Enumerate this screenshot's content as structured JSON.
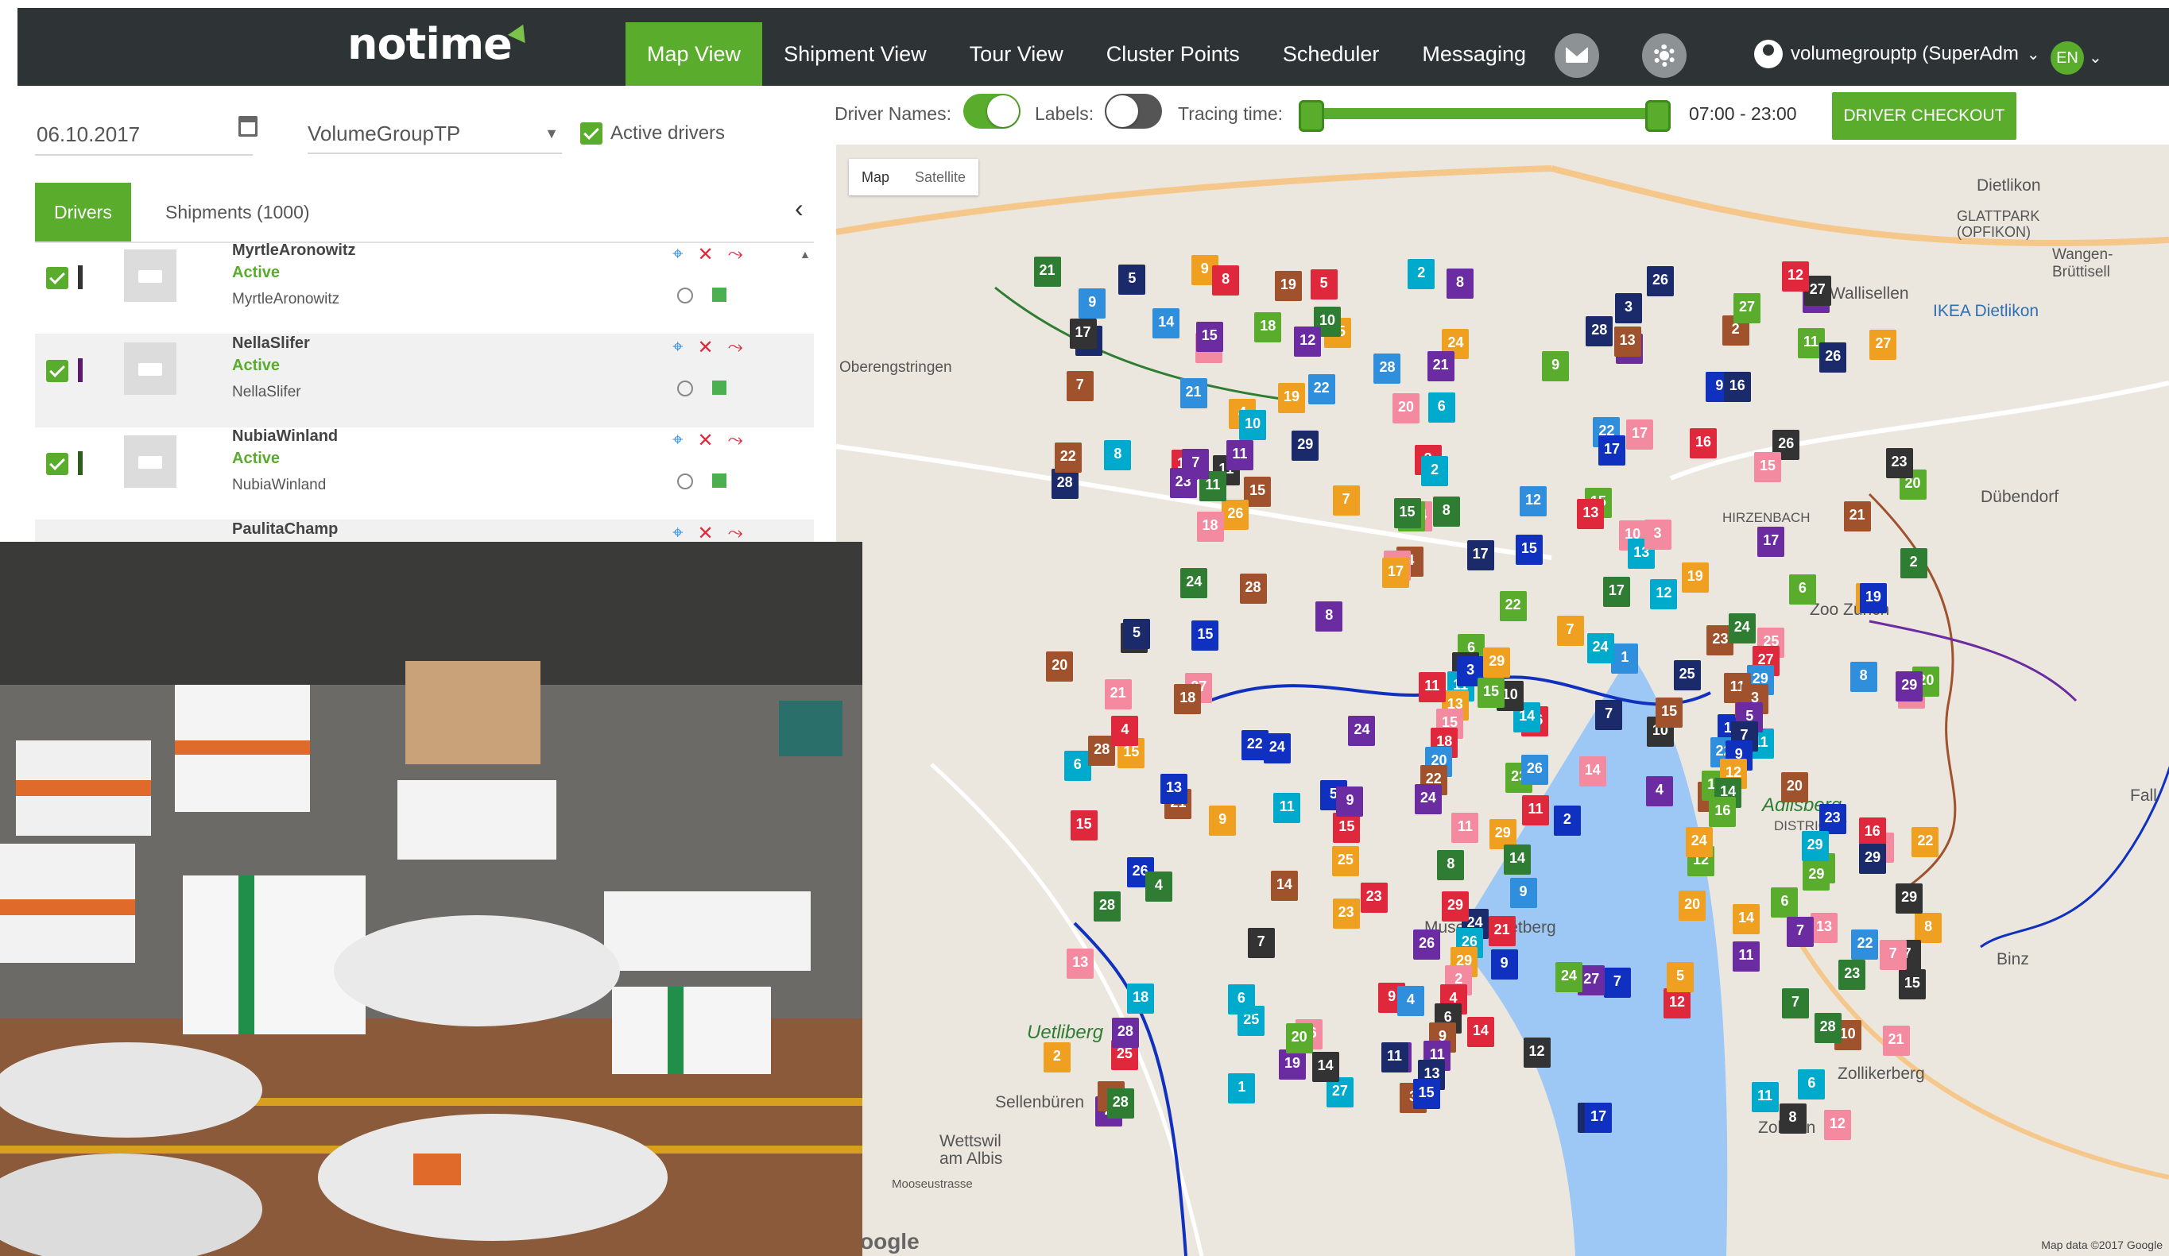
{
  "app": {
    "logo": "notime",
    "nav": [
      {
        "label": "Map View",
        "active": true
      },
      {
        "label": "Shipment View",
        "active": false
      },
      {
        "label": "Tour View",
        "active": false
      },
      {
        "label": "Cluster Points",
        "active": false
      },
      {
        "label": "Scheduler",
        "active": false
      },
      {
        "label": "Messaging",
        "active": false
      }
    ],
    "icons": {
      "messages": "envelope-icon",
      "settings": "gear-icon",
      "user": "user-circle-icon"
    },
    "user_label": "volumegrouptp (SuperAdm",
    "language": "EN"
  },
  "filters": {
    "date": "06.10.2017",
    "group": "VolumeGroupTP",
    "active_drivers_label": "Active drivers",
    "active_drivers_checked": true
  },
  "tabs": {
    "drivers": "Drivers",
    "shipments": "Shipments (1000)"
  },
  "drivers": [
    {
      "name": "MyrtleAronowitz",
      "status": "Active",
      "sub": "MyrtleAronowitz",
      "color": "#333333"
    },
    {
      "name": "NellaSlifer",
      "status": "Active",
      "sub": "NellaSlifer",
      "color": "#5b1a6b"
    },
    {
      "name": "NubiaWinland",
      "status": "Active",
      "sub": "NubiaWinland",
      "color": "#2e5d1e"
    },
    {
      "name": "PaulitaChamp",
      "status": "",
      "sub": "",
      "color": "#333333"
    }
  ],
  "map_toolbar": {
    "driver_names_label": "Driver Names:",
    "driver_names_on": true,
    "labels_label": "Labels:",
    "labels_on": false,
    "tracing_label": "Tracing time:",
    "time_range": "07:00 - 23:00",
    "checkout_label": "DRIVER CHECKOUT"
  },
  "map": {
    "map_type": "Map",
    "satellite": "Satellite",
    "places": [
      "GLATTPARK (OPFIKON)",
      "Dietlikon",
      "Wangen-Brüttisell",
      "Wallisellen",
      "IKEA Dietlikon",
      "Oberengstringen",
      "Dübendorf",
      "HIRZENBACH",
      "Zoo Zürich",
      "Adlisberg",
      "DISTRICT 7",
      "Uetliberg",
      "Sellenbüren",
      "Wettswil am Albis",
      "Zollikerberg",
      "Zollikon",
      "Binz",
      "Museum Rietberg",
      "Fall",
      "Mooseustrasse"
    ],
    "attribution": "Map data ©2017 Google",
    "google": "oogle",
    "pin_colors": [
      "#1030c0",
      "#e0283c",
      "#5aac2d",
      "#6a2ca0",
      "#f0a020",
      "#2f8fdc",
      "#333333",
      "#1a2a6b",
      "#f48aa0",
      "#2e7d32",
      "#a0522d",
      "#00aacc"
    ]
  }
}
